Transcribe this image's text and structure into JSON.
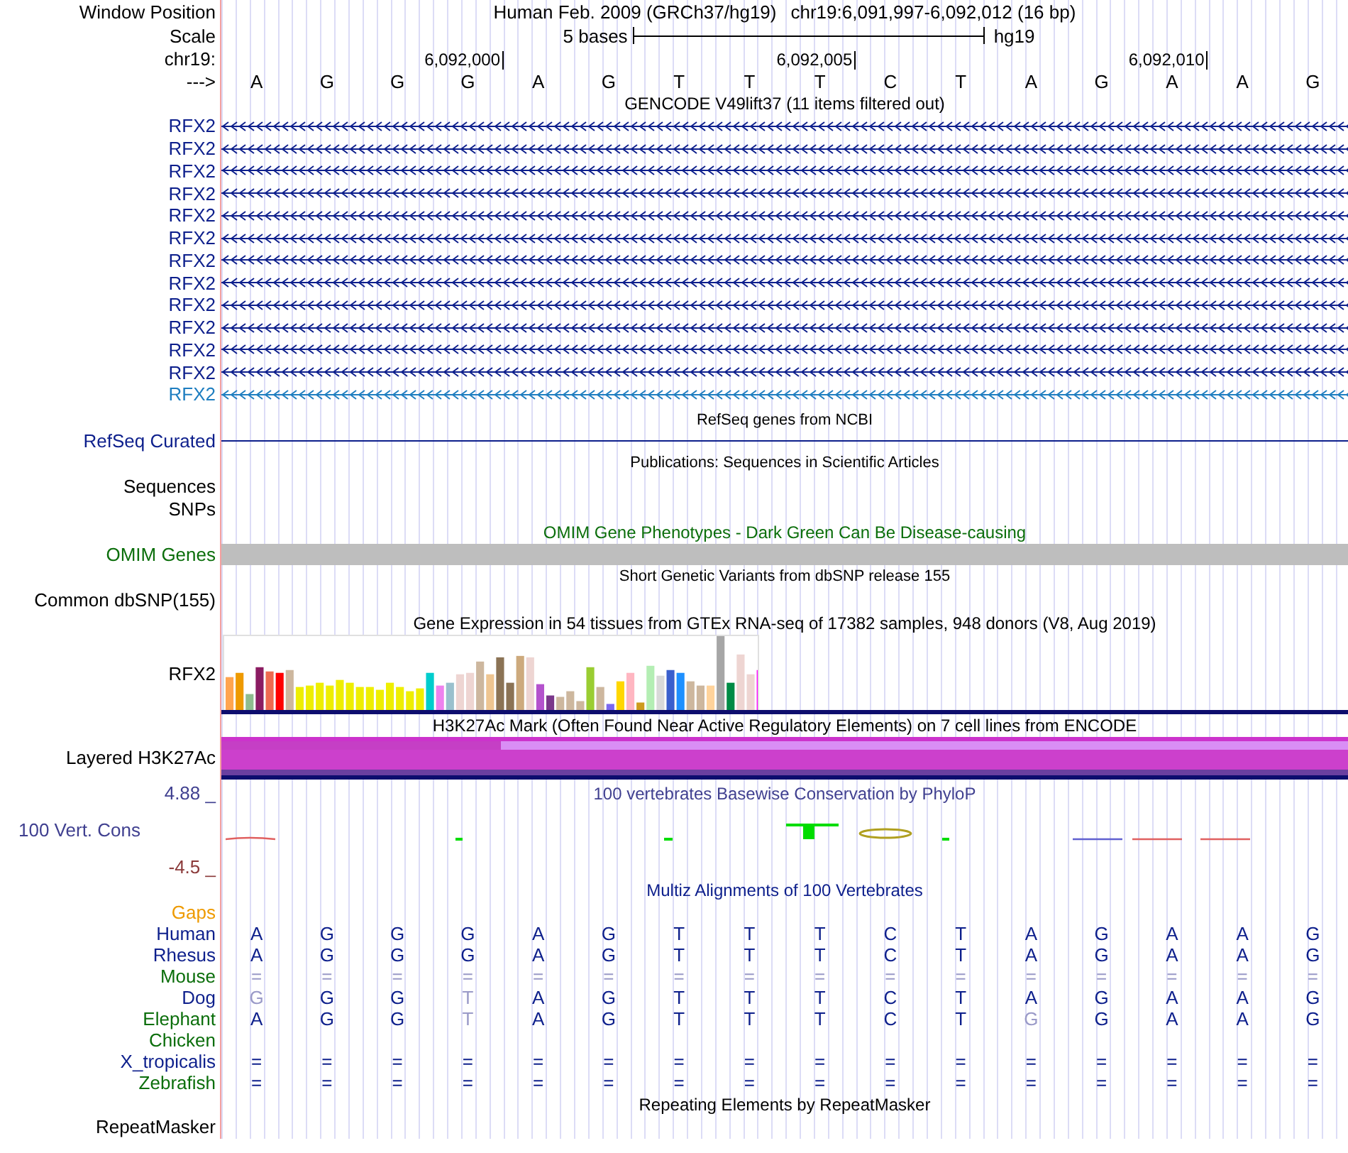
{
  "header": {
    "window_position_label": "Window Position",
    "assembly": "Human Feb. 2009 (GRCh37/hg19)",
    "position": "chr19:6,091,997-6,092,012 (16 bp)",
    "scale_label": "Scale",
    "scale_text": "5 bases",
    "scale_db": "hg19",
    "chrom_label": "chr19:",
    "ticks": [
      "6,092,000",
      "6,092,005",
      "6,092,010"
    ],
    "strand_label": "--->",
    "bases": [
      "A",
      "G",
      "G",
      "G",
      "A",
      "G",
      "T",
      "T",
      "T",
      "C",
      "T",
      "A",
      "G",
      "A",
      "A",
      "G"
    ]
  },
  "gencode": {
    "title": "GENCODE V49lift37 (11 items filtered out)",
    "rows": [
      {
        "name": "RFX2",
        "color": "#0d1f8c"
      },
      {
        "name": "RFX2",
        "color": "#0d1f8c"
      },
      {
        "name": "RFX2",
        "color": "#0d1f8c"
      },
      {
        "name": "RFX2",
        "color": "#0d1f8c"
      },
      {
        "name": "RFX2",
        "color": "#0d1f8c"
      },
      {
        "name": "RFX2",
        "color": "#0d1f8c"
      },
      {
        "name": "RFX2",
        "color": "#0d1f8c"
      },
      {
        "name": "RFX2",
        "color": "#0d1f8c"
      },
      {
        "name": "RFX2",
        "color": "#0d1f8c"
      },
      {
        "name": "RFX2",
        "color": "#0d1f8c"
      },
      {
        "name": "RFX2",
        "color": "#0d1f8c"
      },
      {
        "name": "RFX2",
        "color": "#0d1f8c"
      },
      {
        "name": "RFX2",
        "color": "#1f7ec0"
      }
    ]
  },
  "refseq": {
    "title": "RefSeq genes from NCBI",
    "label": "RefSeq Curated"
  },
  "publications": {
    "title": "Publications: Sequences in Scientific Articles",
    "labels": [
      "Sequences",
      "SNPs"
    ]
  },
  "omim": {
    "title": "OMIM Gene Phenotypes - Dark Green Can Be Disease-causing",
    "label": "OMIM Genes"
  },
  "dbsnp": {
    "title": "Short Genetic Variants from dbSNP release 155",
    "label": "Common dbSNP(155)"
  },
  "gtex": {
    "title": "Gene Expression in 54 tissues from GTEx RNA-seq of 17382 samples, 948 donors (V8, Aug 2019)",
    "label": "RFX2"
  },
  "h3k27ac": {
    "title": "H3K27Ac Mark (Often Found Near Active Regulatory Elements) on 7 cell lines from ENCODE",
    "label": "Layered H3K27Ac"
  },
  "phylop": {
    "title": "100 vertebrates Basewise Conservation by PhyloP",
    "label": "100 Vert. Cons",
    "max": "4.88 _",
    "min": "-4.5 _"
  },
  "multiz": {
    "title": "Multiz Alignments of 100 Vertebrates",
    "gaps_label": "Gaps",
    "species": [
      {
        "name": "Human",
        "color": "#0d1f8c",
        "bases": [
          "A",
          "G",
          "G",
          "G",
          "A",
          "G",
          "T",
          "T",
          "T",
          "C",
          "T",
          "A",
          "G",
          "A",
          "A",
          "G"
        ]
      },
      {
        "name": "Rhesus",
        "color": "#0d1f8c",
        "bases": [
          "A",
          "G",
          "G",
          "G",
          "A",
          "G",
          "T",
          "T",
          "T",
          "C",
          "T",
          "A",
          "G",
          "A",
          "A",
          "G"
        ]
      },
      {
        "name": "Mouse",
        "color": "#0b6e0b",
        "faded": true,
        "bases": [
          "=",
          "=",
          "=",
          "=",
          "=",
          "=",
          "=",
          "=",
          "=",
          "=",
          "=",
          "=",
          "=",
          "=",
          "=",
          "="
        ]
      },
      {
        "name": "Dog",
        "color": "#0d1f8c",
        "bases": [
          "G",
          "G",
          "G",
          "T",
          "A",
          "G",
          "T",
          "T",
          "T",
          "C",
          "T",
          "A",
          "G",
          "A",
          "A",
          "G"
        ],
        "faded_bases": [
          true,
          false,
          false,
          true,
          false,
          false,
          false,
          false,
          false,
          false,
          false,
          false,
          false,
          false,
          false,
          false
        ]
      },
      {
        "name": "Elephant",
        "color": "#0b6e0b",
        "bases": [
          "A",
          "G",
          "G",
          "T",
          "A",
          "G",
          "T",
          "T",
          "T",
          "C",
          "T",
          "G",
          "G",
          "A",
          "A",
          "G"
        ],
        "faded_bases": [
          false,
          false,
          false,
          true,
          false,
          false,
          false,
          false,
          false,
          false,
          false,
          true,
          false,
          false,
          false,
          false
        ]
      },
      {
        "name": "Chicken",
        "color": "#0b6e0b"
      },
      {
        "name": "X_tropicalis",
        "color": "#0d1f8c",
        "bases": [
          "=",
          "=",
          "=",
          "=",
          "=",
          "=",
          "=",
          "=",
          "=",
          "=",
          "=",
          "=",
          "=",
          "=",
          "=",
          "="
        ]
      },
      {
        "name": "Zebrafish",
        "color": "#0b6e0b",
        "bases": [
          "=",
          "=",
          "=",
          "=",
          "=",
          "=",
          "=",
          "=",
          "=",
          "=",
          "=",
          "=",
          "=",
          "=",
          "=",
          "="
        ]
      }
    ]
  },
  "repeatmasker": {
    "title": "Repeating Elements by RepeatMasker",
    "label": "RepeatMasker"
  }
}
